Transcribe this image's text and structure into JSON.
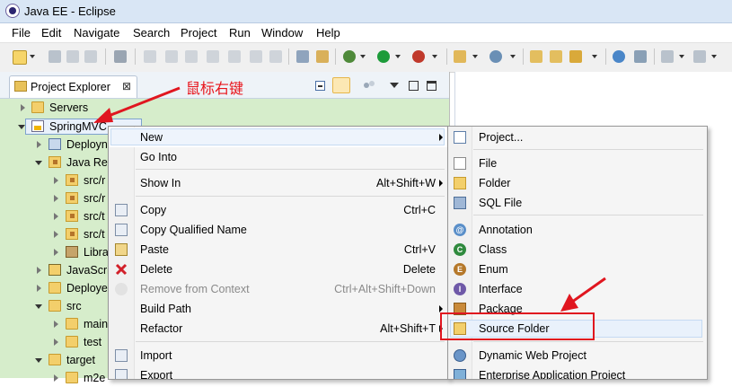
{
  "window": {
    "title": "Java EE - Eclipse"
  },
  "menubar": [
    "File",
    "Edit",
    "Navigate",
    "Search",
    "Project",
    "Run",
    "Window",
    "Help"
  ],
  "explorer": {
    "tab_label": "Project Explorer",
    "close_glyph": "⊠",
    "annotation": "鼠标右键",
    "tree": [
      {
        "label": "Servers"
      },
      {
        "label": "SpringMVC"
      },
      {
        "label": "Deployn"
      },
      {
        "label": "Java Res"
      },
      {
        "label": "src/r"
      },
      {
        "label": "src/r"
      },
      {
        "label": "src/t"
      },
      {
        "label": "src/t"
      },
      {
        "label": "Libra"
      },
      {
        "label": "JavaScri"
      },
      {
        "label": "Deploye"
      },
      {
        "label": "src"
      },
      {
        "label": "main"
      },
      {
        "label": "test"
      },
      {
        "label": "target"
      },
      {
        "label": "m2e"
      }
    ]
  },
  "context_menu": {
    "items": [
      {
        "label": "New",
        "shortcut": ""
      },
      {
        "label": "Go Into",
        "shortcut": ""
      },
      {
        "label": "Show In",
        "shortcut": "Alt+Shift+W"
      },
      {
        "label": "Copy",
        "shortcut": "Ctrl+C"
      },
      {
        "label": "Copy Qualified Name",
        "shortcut": ""
      },
      {
        "label": "Paste",
        "shortcut": "Ctrl+V"
      },
      {
        "label": "Delete",
        "shortcut": "Delete"
      },
      {
        "label": "Remove from Context",
        "shortcut": "Ctrl+Alt+Shift+Down"
      },
      {
        "label": "Build Path",
        "shortcut": ""
      },
      {
        "label": "Refactor",
        "shortcut": "Alt+Shift+T"
      },
      {
        "label": "Import",
        "shortcut": ""
      },
      {
        "label": "Export",
        "shortcut": ""
      }
    ]
  },
  "submenu": {
    "items": [
      {
        "label": "Project..."
      },
      {
        "label": "File"
      },
      {
        "label": "Folder"
      },
      {
        "label": "SQL File"
      },
      {
        "label": "Annotation"
      },
      {
        "label": "Class"
      },
      {
        "label": "Enum"
      },
      {
        "label": "Interface"
      },
      {
        "label": "Package"
      },
      {
        "label": "Source Folder"
      },
      {
        "label": "Dynamic Web Project"
      },
      {
        "label": "Enterprise Application Project"
      }
    ]
  },
  "colors": {
    "tree_background": "#d6edcb",
    "annotation_red": "#e0161f",
    "title_bar": "#d9e6f5"
  }
}
